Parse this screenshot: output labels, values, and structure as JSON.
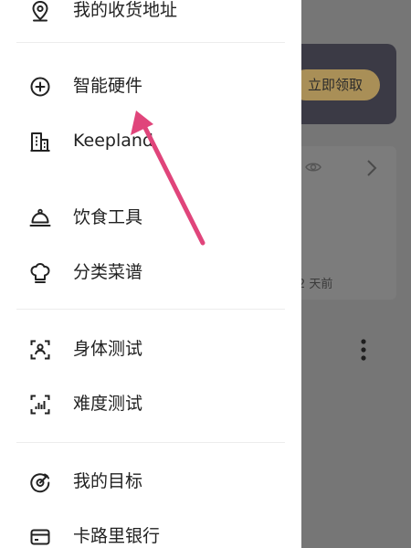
{
  "background": {
    "claim_button": "立即领取",
    "time_ago": "2 天前"
  },
  "menu": {
    "items": [
      {
        "label": "我的收货地址",
        "icon": "location-pin-icon"
      },
      {
        "label": "智能硬件",
        "icon": "plus-circle-icon"
      },
      {
        "label": "Keepland",
        "icon": "building-icon"
      },
      {
        "label": "饮食工具",
        "icon": "cloche-icon"
      },
      {
        "label": "分类菜谱",
        "icon": "chef-hat-icon"
      },
      {
        "label": "身体测试",
        "icon": "body-scan-icon"
      },
      {
        "label": "难度测试",
        "icon": "difficulty-scan-icon"
      },
      {
        "label": "我的目标",
        "icon": "target-icon"
      },
      {
        "label": "卡路里银行",
        "icon": "card-icon"
      }
    ]
  },
  "colors": {
    "annotation_arrow": "#e0457b",
    "accent_gold": "#a98f57",
    "text": "#222222"
  }
}
